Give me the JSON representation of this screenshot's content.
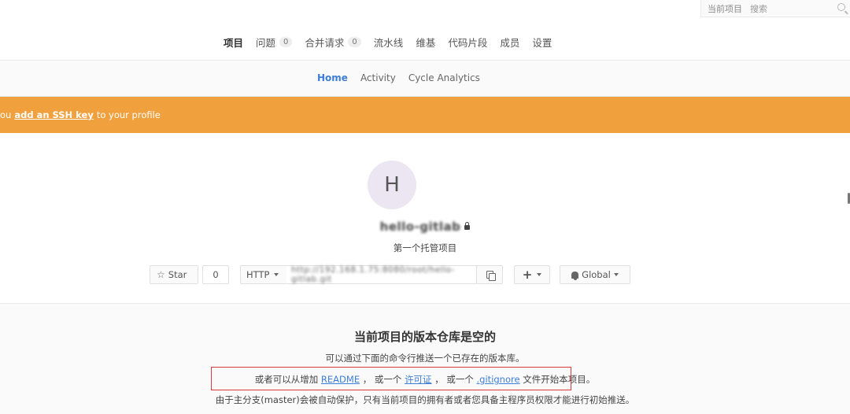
{
  "search": {
    "scope": "当前项目",
    "placeholder": "搜索"
  },
  "top_nav": {
    "items": [
      {
        "label": "项目",
        "active": true
      },
      {
        "label": "问题",
        "badge": "0"
      },
      {
        "label": "合并请求",
        "badge": "0"
      },
      {
        "label": "流水线"
      },
      {
        "label": "维基"
      },
      {
        "label": "代码片段"
      },
      {
        "label": "成员"
      },
      {
        "label": "设置"
      }
    ]
  },
  "sub_nav": {
    "items": [
      "Home",
      "Activity",
      "Cycle Analytics"
    ]
  },
  "banner": {
    "prefix": "ou",
    "link": "add an SSH key",
    "suffix": "to your profile"
  },
  "project": {
    "avatar_letter": "H",
    "name": "hello-gitlab",
    "description": "第一个托管项目"
  },
  "controls": {
    "star_label": "Star",
    "star_count": "0",
    "protocol": "HTTP",
    "clone_url": "http://192.168.1.75:8080/root/hello-gitlab.git",
    "notification": "Global"
  },
  "empty_repo": {
    "title": "当前项目的版本仓库是空的",
    "line1": "可以通过下面的命令行推送一个已存在的版本库。",
    "line2_a": "或者可以从增加",
    "line2_readme": "README",
    "line2_b": "， 或一个",
    "line2_license": "许可证",
    "line2_c": "， 或一个",
    "line2_gitignore": ".gitignore",
    "line2_d": "文件开始本项目。",
    "line3": "由于主分支(master)会被自动保护，只有当前项目的拥有者或者您具备主程序员权限才能进行初始推送。"
  }
}
